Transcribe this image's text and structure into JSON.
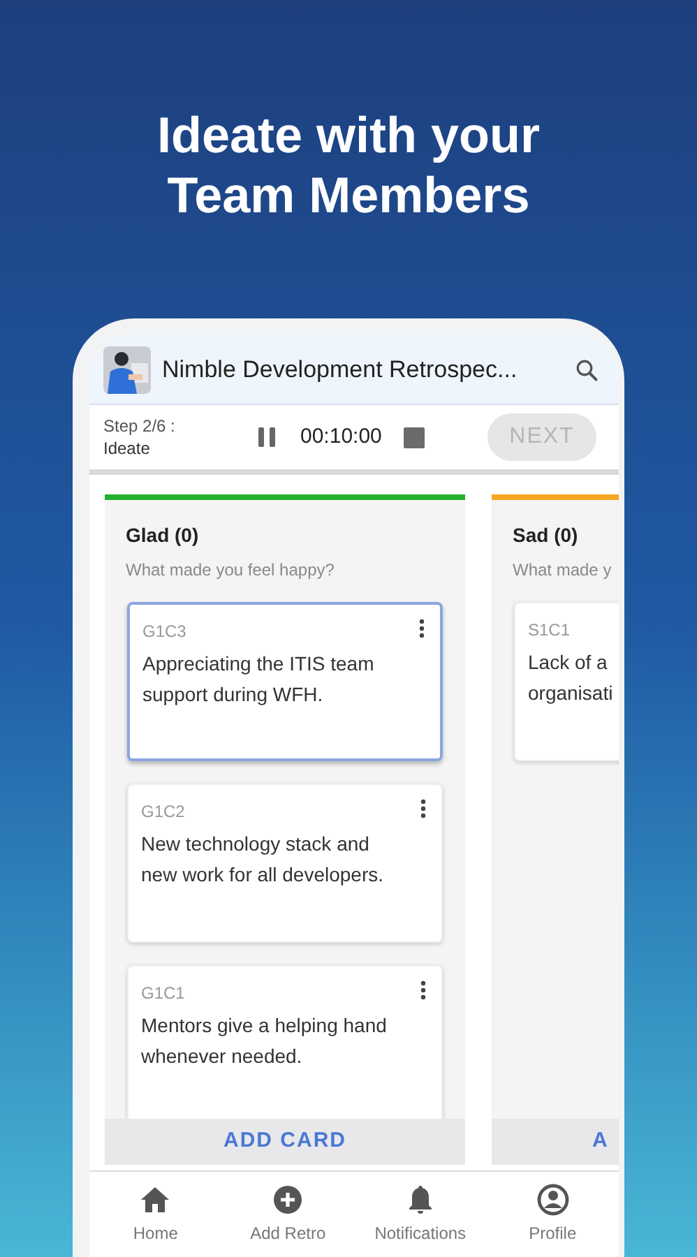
{
  "headline": [
    "Ideate with your",
    "Team Members"
  ],
  "app_bar": {
    "title": "Nimble Development Retrospec..."
  },
  "toolbar": {
    "step": "Step 2/6 :",
    "phase": "Ideate",
    "timer": "00:10:00",
    "next_button": {
      "label": "NEXT",
      "disabled": true
    }
  },
  "columns": [
    {
      "title": "Glad (0)",
      "subtitle": "What made you feel happy?",
      "color": "#22b02e",
      "add_button": "ADD CARD",
      "cards": [
        {
          "id": "G1C3",
          "text": "Appreciating the ITIS team support during WFH.",
          "selected": true,
          "menu": true
        },
        {
          "id": "G1C2",
          "text": "New technology stack and new work for all developers.",
          "selected": false,
          "menu": true
        },
        {
          "id": "G1C1",
          "text": "Mentors give a helping hand whenever needed.",
          "selected": false,
          "menu": true
        }
      ]
    },
    {
      "title": "Sad (0)",
      "subtitle": "What made y",
      "color": "#f5a623",
      "add_button": "A",
      "cards": [
        {
          "id": "S1C1",
          "text": "Lack of a\norganisati",
          "selected": false,
          "menu": false
        }
      ]
    }
  ],
  "nav": [
    {
      "label": "Home",
      "kind": "home"
    },
    {
      "label": "Add Retro",
      "kind": "add"
    },
    {
      "label": "Notifications",
      "kind": "bell"
    },
    {
      "label": "Profile",
      "kind": "profile"
    }
  ]
}
